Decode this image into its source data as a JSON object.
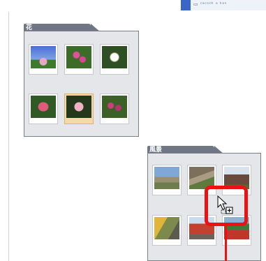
{
  "folders": [
    {
      "label": "花",
      "photos": [
        {
          "name": "flower-photo-1",
          "selected": false
        },
        {
          "name": "flower-photo-2",
          "selected": false
        },
        {
          "name": "flower-photo-3",
          "selected": false
        },
        {
          "name": "flower-photo-4",
          "selected": false
        },
        {
          "name": "flower-photo-5",
          "selected": true
        },
        {
          "name": "flower-photo-6",
          "selected": false
        }
      ]
    },
    {
      "label": "風景",
      "photos": [
        {
          "name": "landscape-photo-1",
          "selected": false
        },
        {
          "name": "landscape-photo-2",
          "selected": false
        },
        {
          "name": "landscape-photo-3",
          "selected": false
        },
        {
          "name": "landscape-photo-4",
          "selected": false
        },
        {
          "name": "landscape-photo-5",
          "selected": false
        },
        {
          "name": "landscape-photo-6",
          "selected": false
        }
      ]
    }
  ],
  "highlight_color": "#ee1111",
  "cursor_icon": "drag-copy-cursor-icon"
}
